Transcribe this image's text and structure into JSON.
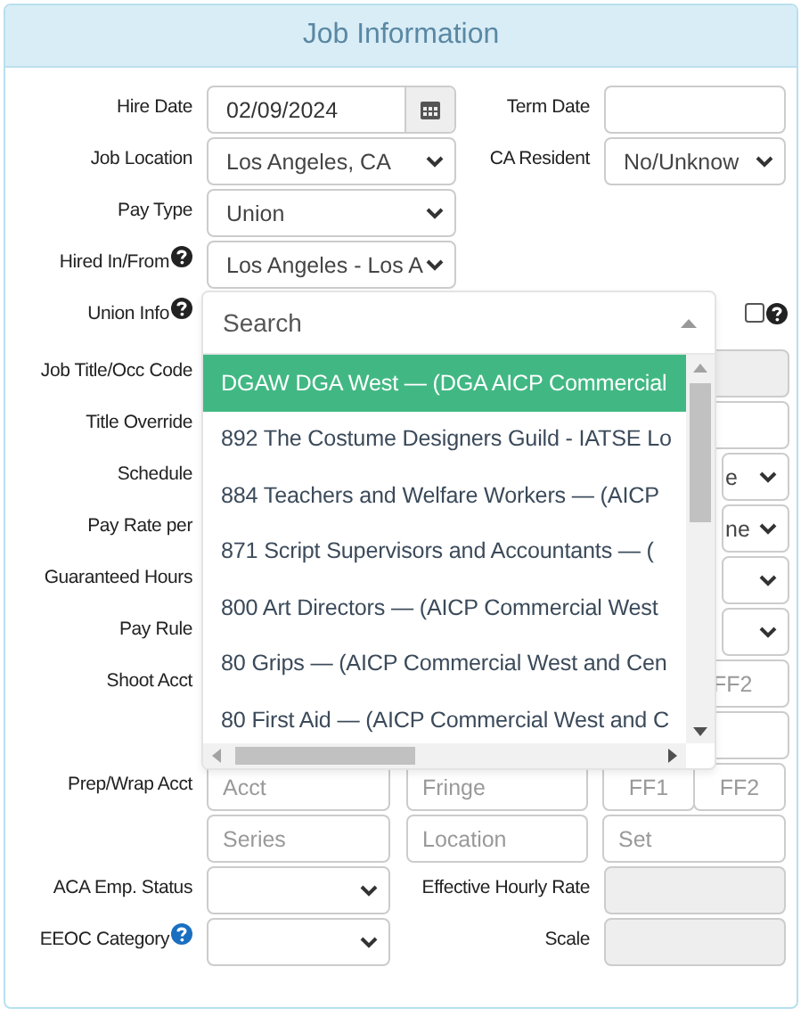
{
  "panel": {
    "title": "Job Information"
  },
  "rows": [
    {
      "kind": "pair",
      "label": "Hire Date",
      "controls": [
        {
          "kind": "date",
          "value": "02/09/2024"
        },
        {
          "kind": "label",
          "text": "Term Date"
        },
        {
          "kind": "text"
        }
      ]
    },
    {
      "kind": "pair",
      "label": "Job Location",
      "controls": [
        {
          "kind": "select",
          "value": "Los Angeles, CA"
        },
        {
          "kind": "label",
          "text": "CA Resident"
        },
        {
          "kind": "select",
          "value": "No/Unknow"
        }
      ]
    },
    {
      "kind": "single",
      "label": "Pay Type",
      "controls": [
        {
          "kind": "select",
          "value": "Union"
        }
      ]
    },
    {
      "kind": "single",
      "label": "Hired In/From",
      "help": true,
      "color": "#222222",
      "controls": [
        {
          "kind": "select",
          "value": "Los Angeles - Los A"
        }
      ]
    },
    {
      "kind": "union",
      "label": "Union Info",
      "help": true,
      "color": "#222222",
      "controls": [
        {
          "kind": "checkbox",
          "checked": false,
          "help": true,
          "color": "#222222"
        }
      ]
    },
    {
      "kind": "edge",
      "label": "Job Title/Occ Code",
      "controls": [
        {
          "kind": "disabled"
        }
      ]
    },
    {
      "kind": "edge",
      "label": "Title Override",
      "controls": [
        {
          "kind": "text"
        }
      ]
    },
    {
      "kind": "edge",
      "label": "Schedule",
      "controls": [
        {
          "kind": "select",
          "value": "e"
        }
      ]
    },
    {
      "kind": "edge",
      "label": "Pay Rate per",
      "controls": [
        {
          "kind": "select",
          "value": "ne"
        }
      ]
    },
    {
      "kind": "edge",
      "label": "Guaranteed Hours",
      "controls": [
        {
          "kind": "select"
        }
      ]
    },
    {
      "kind": "edge",
      "label": "Pay Rule",
      "controls": [
        {
          "kind": "select"
        }
      ]
    },
    {
      "kind": "edge",
      "label": "Shoot Acct",
      "controls": [
        {
          "kind": "text",
          "placeholder": "FF2"
        }
      ]
    },
    {
      "kind": "edge",
      "controls": [
        {
          "kind": "text"
        }
      ]
    },
    {
      "kind": "acct",
      "label": "Prep/Wrap Acct",
      "controls": [
        {
          "kind": "text",
          "placeholder": "Acct"
        },
        {
          "kind": "text",
          "placeholder": "Fringe"
        },
        {
          "kind": "code",
          "placeholder": "FF1"
        },
        {
          "kind": "code",
          "placeholder": "FF2"
        }
      ]
    },
    {
      "kind": "acct3",
      "controls": [
        {
          "kind": "text",
          "placeholder": "Series"
        },
        {
          "kind": "text",
          "placeholder": "Location"
        },
        {
          "kind": "text",
          "placeholder": "Set"
        }
      ]
    },
    {
      "kind": "pair_narrow",
      "label": "ACA Emp. Status",
      "controls": [
        {
          "kind": "select"
        },
        {
          "kind": "label",
          "text": "Effective Hourly Rate"
        },
        {
          "kind": "disabled"
        }
      ]
    },
    {
      "kind": "pair_narrow",
      "label": "EEOC Category",
      "help": true,
      "color": "#1a6fc0",
      "controls": [
        {
          "kind": "select"
        },
        {
          "kind": "label",
          "text": "Scale"
        },
        {
          "kind": "disabled"
        }
      ]
    }
  ],
  "union_dropdown": {
    "placeholder": "Search",
    "options": [
      {
        "label": "DGAW DGA West — (DGA AICP Commercial",
        "selected": true
      },
      {
        "label": "892 The Costume Designers Guild - IATSE Lo",
        "selected": false
      },
      {
        "label": "884 Teachers and Welfare Workers — (AICP",
        "selected": false
      },
      {
        "label": "871 Script Supervisors and Accountants — (",
        "selected": false
      },
      {
        "label": "800 Art Directors — (AICP Commercial West",
        "selected": false
      },
      {
        "label": "80 Grips — (AICP Commercial West and Cen",
        "selected": false
      },
      {
        "label": "80 First Aid — (AICP Commercial West and C",
        "selected": false
      }
    ]
  }
}
